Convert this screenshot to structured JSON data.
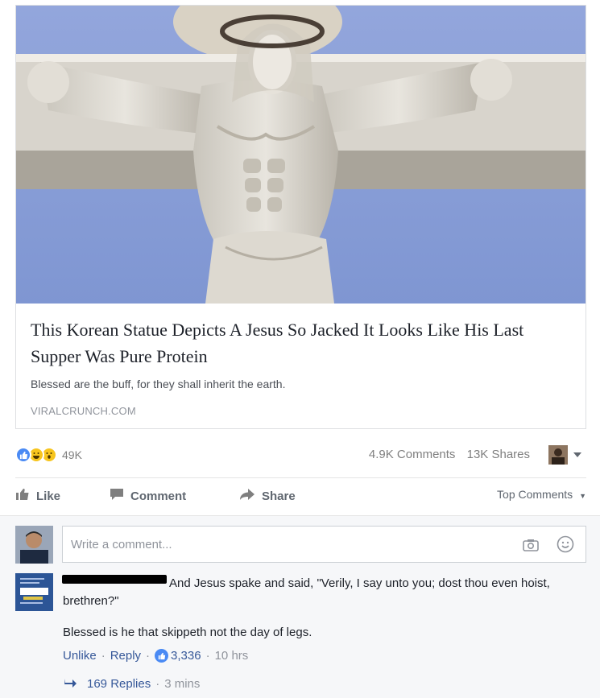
{
  "post": {
    "link": {
      "image_alt": "Muscular Jesus statue on cross",
      "title": "This Korean Statue Depicts A Jesus So Jacked It Looks Like His Last Supper Was Pure Protein",
      "description": "Blessed are the buff, for they shall inherit the earth.",
      "domain": "VIRALCRUNCH.COM"
    },
    "stats": {
      "reactions_count": "49K",
      "comments": "4.9K Comments",
      "shares": "13K Shares",
      "reaction_icons": [
        "like-icon",
        "haha-icon",
        "wow-icon"
      ]
    },
    "actions": {
      "like": "Like",
      "comment": "Comment",
      "share": "Share",
      "sort": "Top Comments"
    }
  },
  "composer": {
    "placeholder": "Write a comment..."
  },
  "comment": {
    "text_line": "And Jesus spake and said, \"Verily, I say unto you; dost thou even hoist, brethren?\"",
    "text_second": "Blessed is he that skippeth not the day of legs.",
    "unlike": "Unlike",
    "reply": "Reply",
    "likes": "3,336",
    "time": "10 hrs",
    "replies": "169 Replies",
    "replies_time": "3 mins"
  },
  "colors": {
    "link": "#365899",
    "like_blue": "#4a8af4",
    "muted": "#90949c"
  }
}
